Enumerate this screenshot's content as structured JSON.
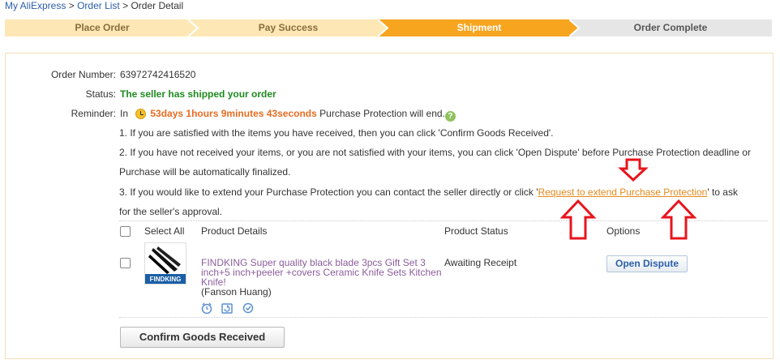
{
  "breadcrumb": {
    "home": "My AliExpress",
    "sep1": ">",
    "order_list": "Order List",
    "sep2": ">",
    "current": "Order Detail"
  },
  "steps": [
    {
      "label": "Place Order",
      "state": "done"
    },
    {
      "label": "Pay Success",
      "state": "done"
    },
    {
      "label": "Shipment",
      "state": "active"
    },
    {
      "label": "Order Complete",
      "state": "pending"
    }
  ],
  "colors": {
    "done": "#fde7b4",
    "active": "#f7a41f",
    "pending": "#e6e6e6",
    "status_green": "#1f8b1f",
    "countdown_orange": "#e76c21",
    "arrow_red": "#e8141c"
  },
  "order": {
    "number_label": "Order Number:",
    "number": "63972742416520",
    "status_label": "Status:",
    "status": "The seller has shipped your order",
    "reminder_label": "Reminder:",
    "reminder_in": "In",
    "countdown": "53days 1hours 9minutes 43seconds",
    "reminder_suffix": "Purchase Protection will end.",
    "help_icon": "?"
  },
  "notes": {
    "n1": "1. If you are satisfied with the items you have received, then you can click 'Confirm Goods Received'.",
    "n2a": "2. If you have not received your items, or you are not satisfied with your items, you can click 'Open Dispute' before Purchase Protection deadline or",
    "n2b": "Purchase will be automatically finalized.",
    "n3a": "3. If you would like to extend your Purchase Protection you can contact the seller directly or click '",
    "n3_link": "Request to extend Purchase Protection",
    "n3c": "' to ask",
    "n3d": "for the seller's approval."
  },
  "table": {
    "select_all": "Select All",
    "col_details": "Product Details",
    "col_status": "Product Status",
    "col_options": "Options"
  },
  "product": {
    "image_brand": "FINDKING",
    "title": "FINDKING Super quality black blade 3pcs Gift Set 3 inch+5 inch+peeler +covers Ceramic Knife Sets Kitchen Knife!",
    "seller": "(Fanson Huang)",
    "status": "Awaiting Receipt",
    "open_dispute": "Open Dispute"
  },
  "confirm_button": "Confirm Goods Received"
}
